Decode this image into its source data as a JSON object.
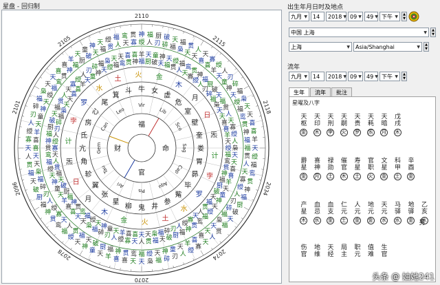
{
  "left_title": "星盘 - 回归制",
  "wheel": {
    "years": [
      "2110",
      "2115",
      "2118",
      "2034",
      "2074",
      "2070",
      "2078",
      "2096",
      "2101",
      "2105"
    ],
    "outer_ring": [
      "天",
      "福",
      "枭",
      "绶",
      "贯",
      "天",
      "福",
      "人",
      "天",
      "鸾",
      "天",
      "喜",
      "贯",
      "寡",
      "喜",
      "神",
      "绶",
      "羊",
      "福",
      "人",
      "天",
      "厨",
      "刃",
      "童",
      "破",
      "碎",
      "神",
      "天",
      "福"
    ],
    "middle_ring": [
      "计",
      "孛",
      "罗",
      "水",
      "土",
      "火",
      "金",
      "木",
      "月",
      "日",
      "炁"
    ],
    "inner_ring": [
      "牛",
      "女",
      "虚",
      "危",
      "室",
      "壁",
      "奎",
      "娄",
      "胃",
      "昴",
      "毕",
      "觜",
      "参",
      "井",
      "鬼",
      "柳",
      "星",
      "张",
      "翼",
      "轸",
      "角",
      "亢",
      "氐",
      "房",
      "心",
      "尾",
      "箕",
      "斗"
    ],
    "center_labels": [
      "Sag",
      "Cap",
      "Aqu",
      "Pis",
      "Ari",
      "Tau",
      "Gem",
      "Can",
      "Leo",
      "Vir",
      "Lib",
      "Sco"
    ],
    "center_text": [
      "命",
      "官",
      "财",
      "福"
    ]
  },
  "birth": {
    "section": "出生年月日时及地点",
    "month": "九月",
    "day": "14",
    "year": "2018",
    "hour": "09",
    "minute": "49",
    "ampm": "下午",
    "country": "中国 上海",
    "city": "上海",
    "tz": "Asia/Shanghai"
  },
  "flow": {
    "section": "流年",
    "month": "九月",
    "day": "14",
    "year": "2018",
    "hour": "09",
    "minute": "49",
    "ampm": "下午"
  },
  "tabs": [
    "生年",
    "流年",
    "批注"
  ],
  "panel_title": "星曜及八字",
  "stars": {
    "row1": [
      [
        "天",
        "枢"
      ],
      [
        "天",
        "印"
      ],
      [
        "天",
        "刑"
      ],
      [
        "天",
        "嗣"
      ],
      [
        "天",
        "贵"
      ],
      [
        "天",
        "耗"
      ],
      [
        "天",
        "暗"
      ],
      [
        "戊",
        "戌"
      ]
    ],
    "row1_c": [
      "金",
      "木",
      "孛",
      "火",
      "罗",
      "炁",
      "月",
      "木"
    ],
    "row2": [
      [
        "爵",
        "星"
      ],
      [
        "喜",
        "神"
      ],
      [
        "禄",
        "勋"
      ],
      [
        "催",
        "官"
      ],
      [
        "寿",
        "星"
      ],
      [
        "官",
        "职"
      ],
      [
        "文",
        "星"
      ],
      [
        "科",
        "甲"
      ],
      [
        "辛",
        "酉"
      ]
    ],
    "row2_c": [
      "金",
      "月",
      "土",
      "木",
      "土",
      "火",
      "金",
      "土",
      "金"
    ],
    "row3": [
      [
        "产",
        "星"
      ],
      [
        "血",
        "忌"
      ],
      [
        "血",
        "支"
      ],
      [
        "仁",
        "元"
      ],
      [
        "人",
        "元"
      ],
      [
        "地",
        "元"
      ],
      [
        "天",
        "元"
      ],
      [
        "马",
        "驿"
      ],
      [
        "地",
        "驿"
      ],
      [
        "乙",
        "亥"
      ]
    ],
    "row3_c": [
      "木",
      "水",
      "金",
      "土",
      "金",
      "金",
      "水",
      "水",
      "金",
      "水"
    ],
    "row4": [
      [
        "伤",
        "官"
      ],
      [
        "地",
        "维"
      ],
      [
        "天",
        "经"
      ],
      [
        "局",
        "主"
      ],
      [
        "职",
        "元"
      ],
      [
        "值",
        "难"
      ],
      [
        "生",
        "官"
      ]
    ],
    "side": [
      "男"
    ],
    "watermark": "头条 @ 妯她241"
  }
}
